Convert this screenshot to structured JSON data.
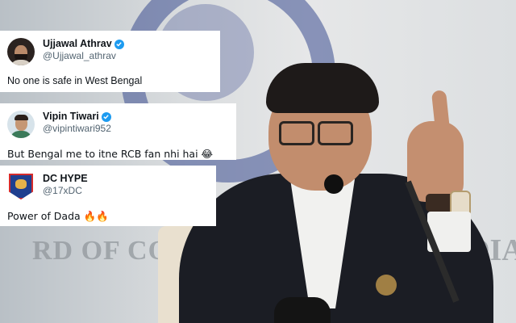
{
  "background": {
    "board_text_left": "RD OF CON",
    "board_text_right": "DIA"
  },
  "tweets": [
    {
      "display_name": "Ujjawal Athrav",
      "handle": "@Ujjawal_athrav",
      "verified": true,
      "text": "No one is safe in West Bengal",
      "avatar": "person-avatar"
    },
    {
      "display_name": "Vipin Tiwari",
      "handle": "@vipintiwari952",
      "verified": true,
      "text": "But Bengal me to itne RCB fan nhi hai 😂",
      "avatar": "person-avatar"
    },
    {
      "display_name": "DC HYPE",
      "handle": "@17xDC",
      "verified": false,
      "text": "Power of Dada 🔥🔥",
      "avatar": "delhi-capitals-logo"
    }
  ],
  "colors": {
    "verified_blue": "#1d9bf0",
    "name_text": "#0f1419",
    "handle_text": "#536471"
  }
}
